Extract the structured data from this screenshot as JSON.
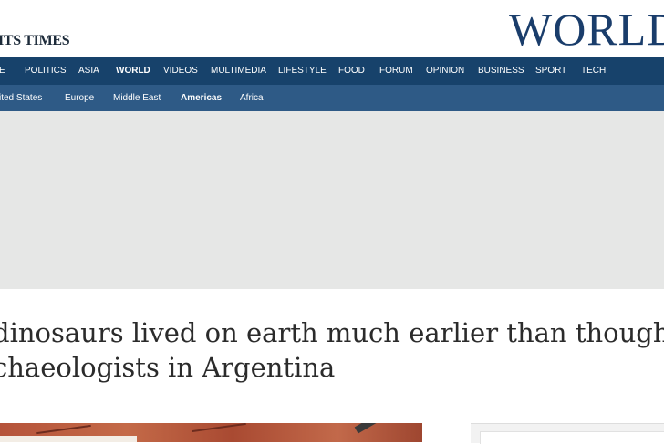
{
  "masthead": {
    "logo_text": "ITS TIMES",
    "section_title": "WORLD"
  },
  "nav_primary": {
    "items": [
      {
        "label": "E",
        "active": false
      },
      {
        "label": "POLITICS",
        "active": false
      },
      {
        "label": "ASIA",
        "active": false
      },
      {
        "label": "WORLD",
        "active": true
      },
      {
        "label": "VIDEOS",
        "active": false
      },
      {
        "label": "MULTIMEDIA",
        "active": false
      },
      {
        "label": "LIFESTYLE",
        "active": false
      },
      {
        "label": "FOOD",
        "active": false
      },
      {
        "label": "FORUM",
        "active": false
      },
      {
        "label": "OPINION",
        "active": false
      },
      {
        "label": "BUSINESS",
        "active": false
      },
      {
        "label": "SPORT",
        "active": false
      },
      {
        "label": "TECH",
        "active": false
      }
    ]
  },
  "nav_secondary": {
    "items": [
      {
        "label": "ited States",
        "active": false
      },
      {
        "label": "Europe",
        "active": false
      },
      {
        "label": "Middle East",
        "active": false
      },
      {
        "label": "Americas",
        "active": true
      },
      {
        "label": "Africa",
        "active": false
      }
    ]
  },
  "article": {
    "headline_line1": "dinosaurs lived on earth much earlier than thought,",
    "headline_line2": "chaeologists in Argentina"
  },
  "colors": {
    "nav_primary_bg": "#17426b",
    "nav_secondary_bg": "#2e5a86",
    "section_title": "#1a3d6b",
    "ad_bg": "#e6e7e6"
  }
}
